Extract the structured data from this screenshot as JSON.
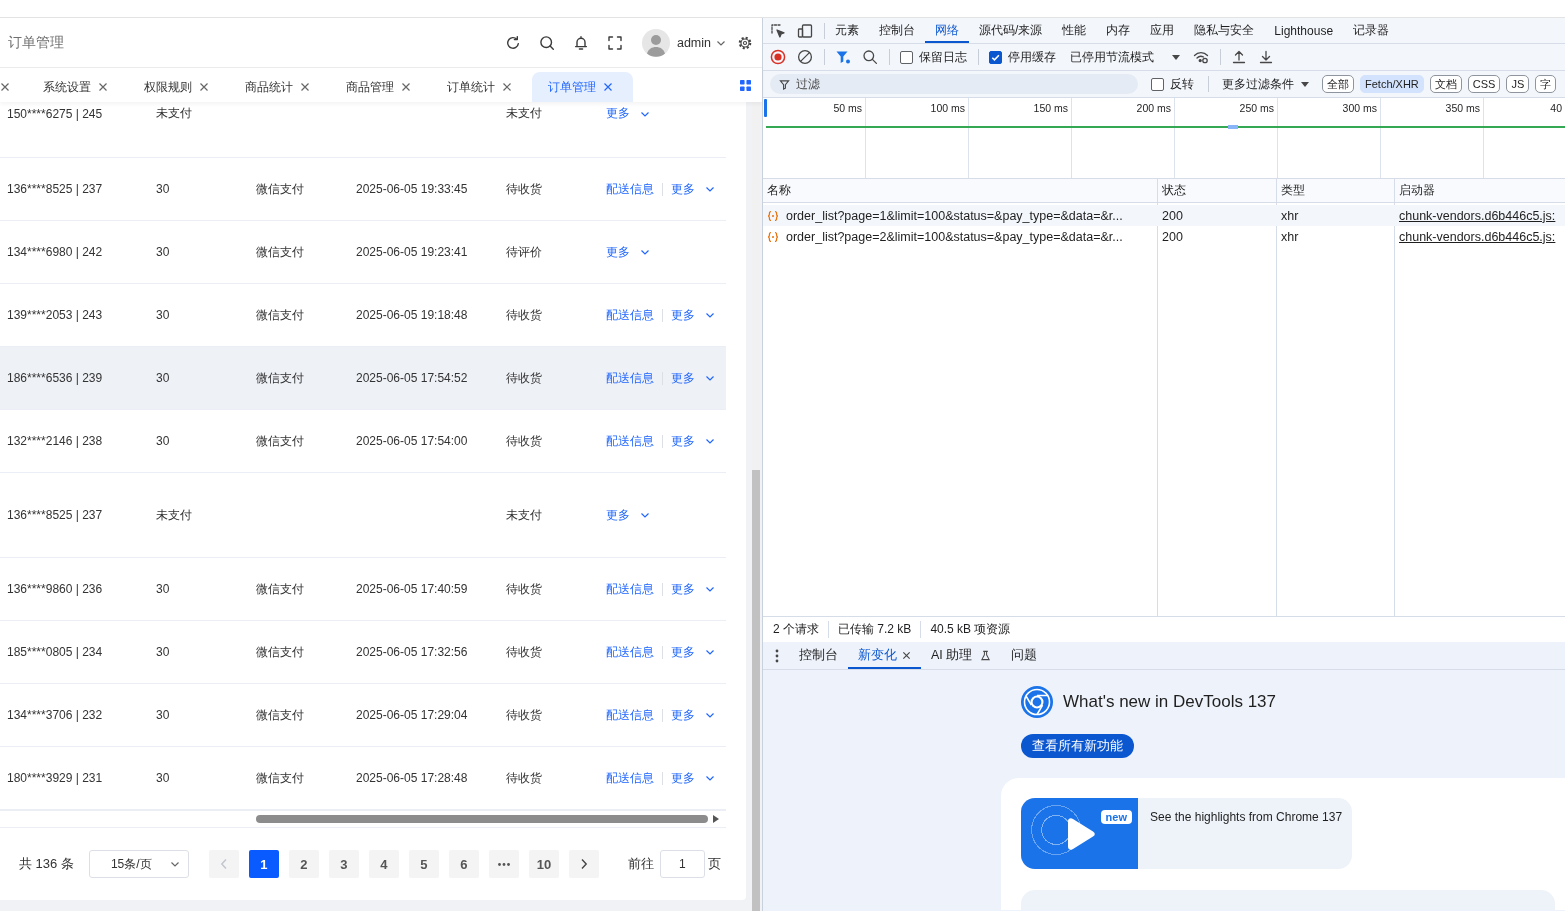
{
  "app_header": {
    "breadcrumb": "订单管理",
    "user": "admin"
  },
  "tabs": [
    {
      "selected": false
    },
    {
      "label": "系统设置",
      "selected": false
    },
    {
      "label": "权限规则",
      "selected": false
    },
    {
      "label": "商品统计",
      "selected": false
    },
    {
      "label": "商品管理",
      "selected": false
    },
    {
      "label": "订单统计",
      "selected": false
    },
    {
      "label": "订单管理",
      "selected": true
    }
  ],
  "orders": {
    "rows": [
      {
        "cells": [
          "150****6275 | 245",
          "未支付",
          null,
          null,
          "未支付"
        ],
        "highlighted": false,
        "actions": [
          {
            "kind": "dropdown",
            "label": "更多"
          }
        ]
      },
      {
        "cells": [
          "136****8525 | 237",
          "30",
          "微信支付",
          "2025-06-05 19:33:45",
          "待收货"
        ],
        "highlighted": false,
        "actions": [
          {
            "kind": "link",
            "label": "配送信息"
          },
          {
            "kind": "dropdown",
            "label": "更多"
          }
        ]
      },
      {
        "cells": [
          "134****6980 | 242",
          "30",
          "微信支付",
          "2025-06-05 19:23:41",
          "待评价"
        ],
        "highlighted": false,
        "actions": [
          {
            "kind": "dropdown",
            "label": "更多"
          }
        ]
      },
      {
        "cells": [
          "139****2053 | 243",
          "30",
          "微信支付",
          "2025-06-05 19:18:48",
          "待收货"
        ],
        "highlighted": false,
        "actions": [
          {
            "kind": "link",
            "label": "配送信息"
          },
          {
            "kind": "dropdown",
            "label": "更多"
          }
        ]
      },
      {
        "cells": [
          "186****6536 | 239",
          "30",
          "微信支付",
          "2025-06-05 17:54:52",
          "待收货"
        ],
        "highlighted": true,
        "actions": [
          {
            "kind": "link",
            "label": "配送信息"
          },
          {
            "kind": "dropdown",
            "label": "更多"
          }
        ]
      },
      {
        "cells": [
          "132****2146 | 238",
          "30",
          "微信支付",
          "2025-06-05 17:54:00",
          "待收货"
        ],
        "highlighted": false,
        "actions": [
          {
            "kind": "link",
            "label": "配送信息"
          },
          {
            "kind": "dropdown",
            "label": "更多"
          }
        ]
      },
      {
        "cells": [
          "136****8525 | 237",
          "未支付",
          null,
          null,
          "未支付"
        ],
        "highlighted": false,
        "actions": [
          {
            "kind": "dropdown",
            "label": "更多"
          }
        ]
      },
      {
        "cells": [
          "136****9860 | 236",
          "30",
          "微信支付",
          "2025-06-05 17:40:59",
          "待收货"
        ],
        "highlighted": false,
        "actions": [
          {
            "kind": "link",
            "label": "配送信息"
          },
          {
            "kind": "dropdown",
            "label": "更多"
          }
        ]
      },
      {
        "cells": [
          "185****0805 | 234",
          "30",
          "微信支付",
          "2025-06-05 17:32:56",
          "待收货"
        ],
        "highlighted": false,
        "actions": [
          {
            "kind": "link",
            "label": "配送信息"
          },
          {
            "kind": "dropdown",
            "label": "更多"
          }
        ]
      },
      {
        "cells": [
          "134****3706 | 232",
          "30",
          "微信支付",
          "2025-06-05 17:29:04",
          "待收货"
        ],
        "highlighted": false,
        "actions": [
          {
            "kind": "link",
            "label": "配送信息"
          },
          {
            "kind": "dropdown",
            "label": "更多"
          }
        ]
      },
      {
        "cells": [
          "180****3929 | 231",
          "30",
          "微信支付",
          "2025-06-05 17:28:48",
          "待收货"
        ],
        "highlighted": false,
        "actions": [
          {
            "kind": "link",
            "label": "配送信息"
          },
          {
            "kind": "dropdown",
            "label": "更多"
          }
        ]
      }
    ]
  },
  "pagination": {
    "total": "共 136 条",
    "page_size": "15条/页",
    "prev": {
      "disabled": true
    },
    "pages": [
      {
        "kind": "page",
        "label": "1",
        "selected": true
      },
      {
        "kind": "page",
        "label": "2",
        "selected": false
      },
      {
        "kind": "page",
        "label": "3",
        "selected": false
      },
      {
        "kind": "page",
        "label": "4",
        "selected": false
      },
      {
        "kind": "page",
        "label": "5",
        "selected": false
      },
      {
        "kind": "page",
        "label": "6",
        "selected": false
      },
      {
        "kind": "ellipsis",
        "selected": false
      },
      {
        "kind": "page",
        "label": "10",
        "selected": false
      }
    ],
    "next": {
      "disabled": false
    },
    "goto_label": "前往",
    "goto_value": "1",
    "goto_unit": "页"
  },
  "devtools": {
    "panel_tabs": [
      {
        "label": "元素",
        "selected": false
      },
      {
        "label": "控制台",
        "selected": false
      },
      {
        "label": "网络",
        "selected": true
      },
      {
        "label": "源代码/来源",
        "selected": false
      },
      {
        "label": "性能",
        "selected": false
      },
      {
        "label": "内存",
        "selected": false
      },
      {
        "label": "应用",
        "selected": false
      },
      {
        "label": "隐私与安全",
        "selected": false
      },
      {
        "label": "Lighthouse",
        "selected": false
      },
      {
        "label": "记录器",
        "selected": false
      }
    ],
    "network_toolbar": {
      "recording": true,
      "preserve_log": {
        "label": "保留日志",
        "checked": false
      },
      "disable_cache": {
        "label": "停用缓存",
        "checked": true
      },
      "throttling": "已停用节流模式"
    },
    "filter_bar": {
      "placeholder": "过滤",
      "invert": {
        "label": "反转",
        "checked": false
      },
      "more_filters": "更多过滤条件",
      "types": [
        {
          "label": "全部",
          "selected": false
        },
        {
          "label": "Fetch/XHR",
          "selected": true
        },
        {
          "label": "文档",
          "selected": false
        },
        {
          "label": "CSS",
          "selected": false
        },
        {
          "label": "JS",
          "selected": false
        },
        {
          "label": "字",
          "selected": false
        }
      ]
    },
    "overview": {
      "ticks": [
        "50 ms",
        "100 ms",
        "150 ms",
        "200 ms",
        "250 ms",
        "300 ms",
        "350 ms",
        "40"
      ]
    },
    "requests": {
      "columns": [
        "名称",
        "状态",
        "类型",
        "启动器"
      ],
      "rows": [
        {
          "name": "order_list?page=1&limit=100&status=&pay_type=&data=&r...",
          "status": "200",
          "type": "xhr",
          "initiator": "chunk-vendors.d6b446c5.js:"
        },
        {
          "name": "order_list?page=2&limit=100&status=&pay_type=&data=&r...",
          "status": "200",
          "type": "xhr",
          "initiator": "chunk-vendors.d6b446c5.js:"
        }
      ]
    },
    "summary": [
      "2 个请求",
      "已传输 7.2 kB",
      "40.5 kB 项资源"
    ],
    "drawer": {
      "tabs": [
        {
          "label": "控制台",
          "selected": false,
          "closable": false,
          "experimental": false
        },
        {
          "label": "新变化",
          "selected": true,
          "closable": true,
          "experimental": false
        },
        {
          "label": "AI 助理",
          "selected": false,
          "closable": false,
          "experimental": true
        },
        {
          "label": "问题",
          "selected": false,
          "closable": false,
          "experimental": false
        }
      ],
      "whats_new": {
        "title": "What's new in DevTools 137",
        "button": "查看所有新功能",
        "video": {
          "badge": "new",
          "caption": "See the highlights from Chrome 137"
        }
      }
    }
  }
}
